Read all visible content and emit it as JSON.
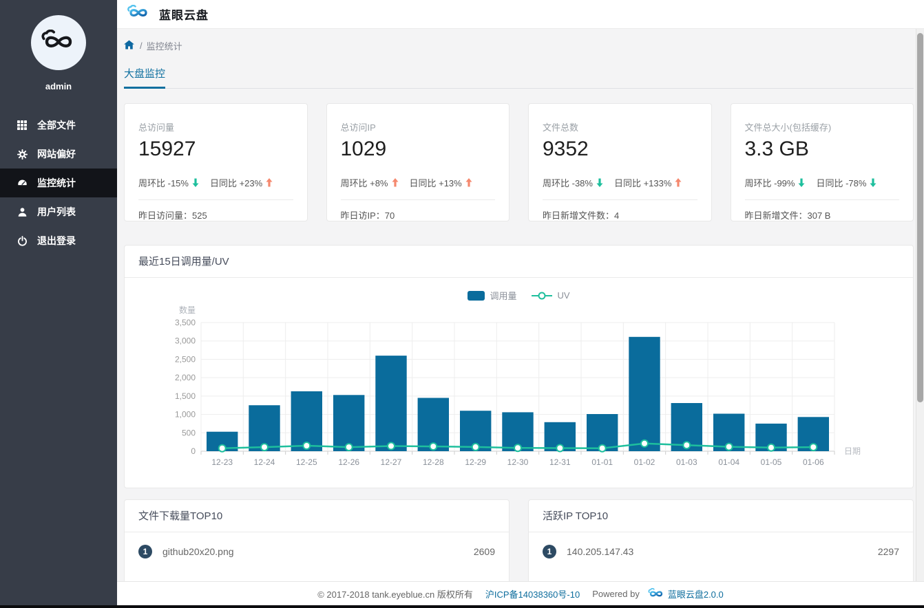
{
  "app": {
    "title": "蓝眼云盘"
  },
  "sidebar": {
    "username": "admin",
    "items": [
      {
        "key": "all-files",
        "label": "全部文件",
        "icon": "grid-icon",
        "active": false
      },
      {
        "key": "site-pref",
        "label": "网站偏好",
        "icon": "gear-icon",
        "active": false
      },
      {
        "key": "monitor",
        "label": "监控统计",
        "icon": "dashboard-icon",
        "active": true
      },
      {
        "key": "user-list",
        "label": "用户列表",
        "icon": "user-icon",
        "active": false
      },
      {
        "key": "logout",
        "label": "退出登录",
        "icon": "power-icon",
        "active": false
      }
    ]
  },
  "breadcrumb": {
    "home_icon": "home-icon",
    "separator": "/",
    "current": "监控统计"
  },
  "tabs": [
    {
      "label": "大盘监控",
      "active": true
    }
  ],
  "stat_cards": [
    {
      "label": "总访问量",
      "value": "15927",
      "trends": [
        {
          "text": "周环比 -15%",
          "dir": "down"
        },
        {
          "text": "日同比 +23%",
          "dir": "up"
        }
      ],
      "footer_label": "昨日访问量：",
      "footer_value": "525"
    },
    {
      "label": "总访问IP",
      "value": "1029",
      "trends": [
        {
          "text": "周环比 +8%",
          "dir": "up"
        },
        {
          "text": "日同比 +13%",
          "dir": "up"
        }
      ],
      "footer_label": "昨日访IP：",
      "footer_value": "70"
    },
    {
      "label": "文件总数",
      "value": "9352",
      "trends": [
        {
          "text": "周环比 -38%",
          "dir": "down"
        },
        {
          "text": "日同比 +133%",
          "dir": "up"
        }
      ],
      "footer_label": "昨日新增文件数：",
      "footer_value": "4"
    },
    {
      "label": "文件总大小(包括缓存)",
      "value": "3.3 GB",
      "trends": [
        {
          "text": "周环比 -99%",
          "dir": "down"
        },
        {
          "text": "日同比 -78%",
          "dir": "down"
        }
      ],
      "footer_label": "昨日新增文件：",
      "footer_value": "307 B"
    }
  ],
  "chart_card": {
    "title": "最近15日调用量/UV"
  },
  "chart_data": {
    "type": "bar",
    "title": "最近15日调用量/UV",
    "categories": [
      "12-23",
      "12-24",
      "12-25",
      "12-26",
      "12-27",
      "12-28",
      "12-29",
      "12-30",
      "12-31",
      "01-01",
      "01-02",
      "01-03",
      "01-04",
      "01-05",
      "01-06"
    ],
    "series": [
      {
        "name": "调用量",
        "type": "bar",
        "color": "#0a6c9c",
        "values": [
          530,
          1250,
          1630,
          1530,
          2600,
          1450,
          1100,
          1060,
          790,
          1010,
          3110,
          1310,
          1020,
          750,
          930
        ]
      },
      {
        "name": "UV",
        "type": "line",
        "color": "#1ebf9d",
        "values": [
          80,
          110,
          150,
          110,
          140,
          130,
          115,
          90,
          85,
          80,
          210,
          165,
          120,
          100,
          110
        ]
      }
    ],
    "xlabel": "日期",
    "ylabel": "数量",
    "ylim": [
      0,
      3500
    ],
    "ytick_step": 500,
    "grid": true,
    "legend_position": "top"
  },
  "top_lists": [
    {
      "title": "文件下载量TOP10",
      "rows": [
        {
          "rank": "1",
          "name": "github20x20.png",
          "value": "2609"
        }
      ]
    },
    {
      "title": "活跃IP TOP10",
      "rows": [
        {
          "rank": "1",
          "name": "140.205.147.43",
          "value": "2297"
        }
      ]
    }
  ],
  "footer": {
    "copyright": "© 2017-2018 tank.eyeblue.cn 版权所有",
    "icp": "沪ICP备14038360号-10",
    "powered_prefix": "Powered by",
    "powered_name": "蓝眼云盘2.0.0"
  },
  "colors": {
    "accent": "#0e6f9f",
    "bar": "#0a6c9c",
    "teal": "#1ebf9d",
    "salmon": "#f5886e",
    "sidebar": "#373d48",
    "sidebar_active": "#121419",
    "badge": "#2d4a63",
    "grid_line": "#ededed",
    "axis_line": "#cccccc",
    "tick_text": "#999999"
  }
}
